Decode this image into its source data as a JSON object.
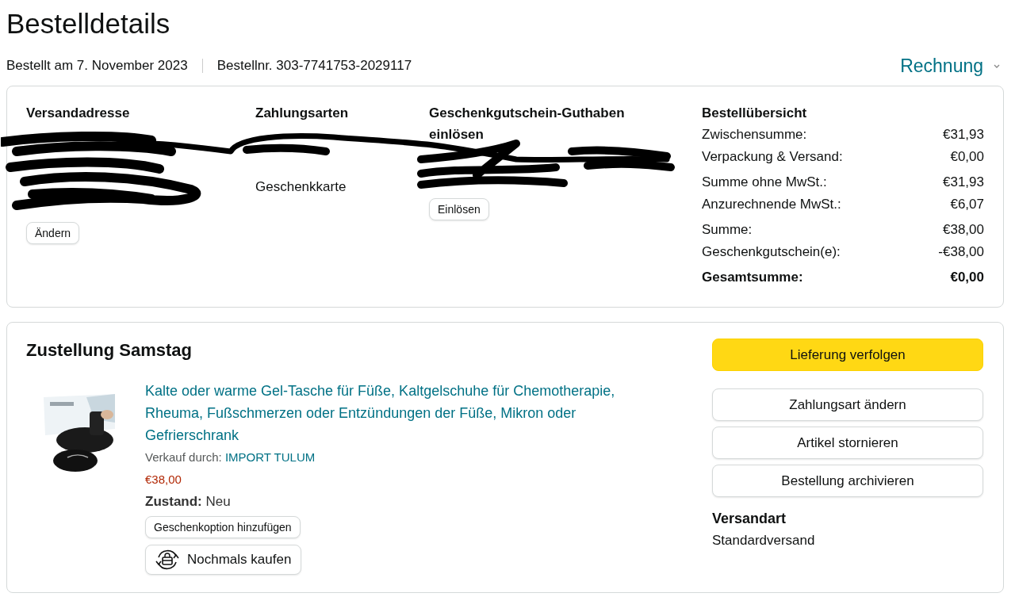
{
  "page_title": "Bestelldetails",
  "order_date": "Bestellt am 7. November 2023",
  "order_number": "Bestellnr. 303-7741753-2029117",
  "invoice_menu": {
    "label": "Rechnung"
  },
  "summary_card": {
    "shipping_address": {
      "heading": "Versandadresse",
      "button": "Ändern"
    },
    "payment_methods": {
      "heading": "Zahlungsarten",
      "lines": [
        "Geschenkkarte"
      ]
    },
    "gift_card": {
      "heading": "Geschenkgutschein-Guthaben einlösen",
      "button": "Einlösen"
    },
    "order_summary": {
      "heading": "Bestellübersicht",
      "groups": [
        [
          {
            "label": "Zwischensumme:",
            "value": "€31,93"
          },
          {
            "label": "Verpackung & Versand:",
            "value": "€0,00"
          }
        ],
        [
          {
            "label": "Summe ohne MwSt.:",
            "value": "€31,93"
          },
          {
            "label": "Anzurechnende MwSt.:",
            "value": "€6,07"
          }
        ],
        [
          {
            "label": "Summe:",
            "value": "€38,00"
          },
          {
            "label": "Geschenkgutschein(e):",
            "value": "-€38,00"
          }
        ]
      ],
      "total": {
        "label": "Gesamtsumme:",
        "value": "€0,00"
      }
    }
  },
  "shipment": {
    "heading": "Zustellung Samstag",
    "item": {
      "kind": "picture",
      "title": "Kalte oder warme Gel-Tasche für Füße, Kaltgelschuhe für Chemotherapie, Rheuma, Fußschmerzen oder Entzündungen der Füße, Mikron oder Gefrierschrank",
      "seller_label": "Verkauf durch:",
      "seller": "IMPORT TULUM",
      "price": "€38,00",
      "condition_label": "Zustand:",
      "condition": "Neu",
      "gift_button": "Geschenkoption hinzufügen",
      "buy_again_button": "Nochmals kaufen"
    },
    "actions": [
      {
        "label": "Lieferung verfolgen",
        "kind": "primary"
      },
      {
        "label": "Zahlungsart ändern",
        "kind": "secondary"
      },
      {
        "label": "Artikel stornieren",
        "kind": "secondary"
      },
      {
        "label": "Bestellung archivieren",
        "kind": "secondary"
      }
    ],
    "shipping_method": {
      "heading": "Versandart",
      "value": "Standardversand"
    }
  }
}
